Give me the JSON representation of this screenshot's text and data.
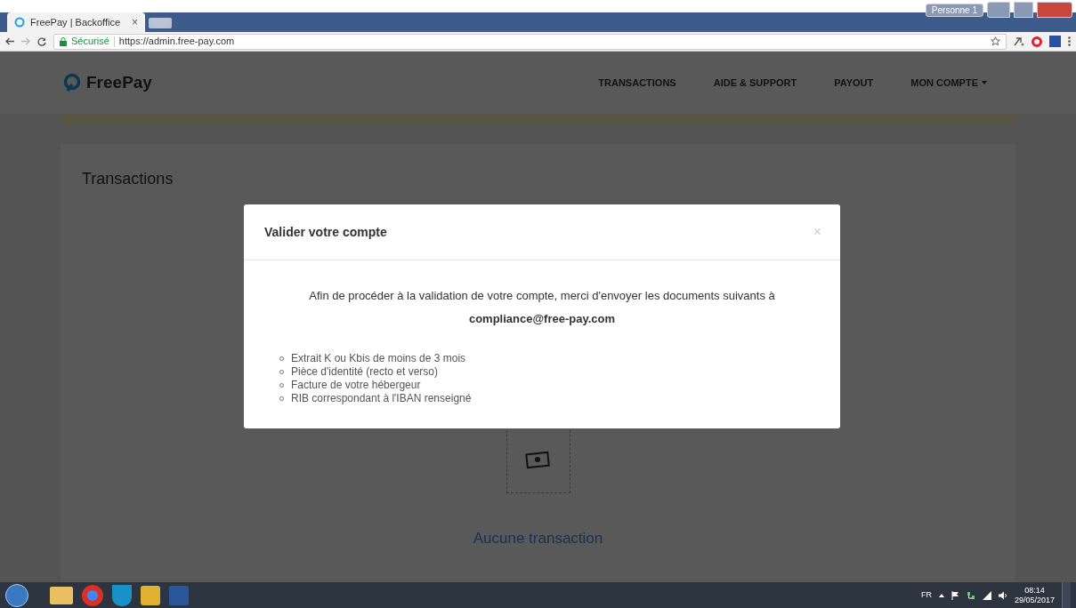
{
  "browser": {
    "tab_title": "FreePay | Backoffice",
    "tab_close": "×",
    "profile": "Personne 1",
    "secure_label": "Sécurisé",
    "url": "https://admin.free-pay.com"
  },
  "site": {
    "logo": "FreePay",
    "nav": [
      {
        "label": "TRANSACTIONS"
      },
      {
        "label": "AIDE & SUPPORT"
      },
      {
        "label": "PAYOUT"
      },
      {
        "label": "MON COMPTE",
        "dropdown": true
      }
    ]
  },
  "card": {
    "title": "Transactions",
    "empty_text": "Aucune transaction"
  },
  "modal": {
    "title": "Valider votre compte",
    "close": "×",
    "intro": "Afin de procéder à la validation de votre compte, merci d'envoyer les documents suivants à",
    "email": "compliance@free-pay.com",
    "documents": [
      "Extrait K ou Kbis de moins de 3 mois",
      "Pièce d'identité (recto et verso)",
      "Facture de votre hébergeur",
      "RIB correspondant à l'IBAN renseigné"
    ]
  },
  "taskbar": {
    "language": "FR",
    "time": "08:14",
    "date": "29/05/2017"
  }
}
